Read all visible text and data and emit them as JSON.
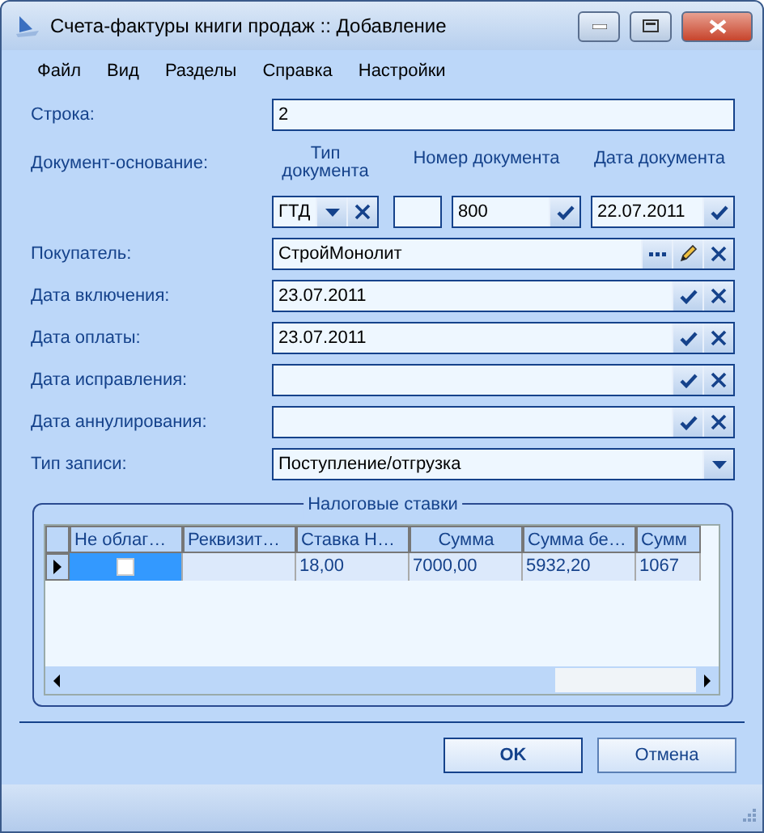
{
  "window": {
    "title": "Счета-фактуры книги продаж :: Добавление"
  },
  "menu": [
    "Файл",
    "Вид",
    "Разделы",
    "Справка",
    "Настройки"
  ],
  "row_field": {
    "label": "Строка:",
    "value": "2"
  },
  "document_basis": {
    "label": "Документ-основание:",
    "headers": [
      "Тип документа",
      "Номер документа",
      "Дата документа"
    ],
    "type": "ГТД",
    "number": "800",
    "date": "22.07.2011"
  },
  "fields": [
    {
      "label": "Покупатель:",
      "value": "СтройМонолит",
      "kind": "lookup"
    },
    {
      "label": "Дата включения:",
      "value": "23.07.2011",
      "kind": "date"
    },
    {
      "label": "Дата оплаты:",
      "value": "23.07.2011",
      "kind": "date"
    },
    {
      "label": "Дата исправления:",
      "kind": "date"
    },
    {
      "label": "Дата аннулирования:",
      "kind": "date"
    },
    {
      "label": "Тип записи:",
      "value": "Поступление/отгрузка",
      "kind": "combo"
    }
  ],
  "tax_rates": {
    "title": "Налоговые ставки",
    "columns": [
      "Не облаг…",
      "Реквизит…",
      "Ставка Н…",
      "Сумма",
      "Сумма бе…",
      "Сумм"
    ],
    "rows": [
      {
        "selected": true,
        "checked": false,
        "cells": [
          "",
          "",
          "18,00",
          "7000,00",
          "5932,20",
          "1067"
        ]
      }
    ]
  },
  "buttons": [
    {
      "label": "OK",
      "default": true
    },
    {
      "label": "Отмена",
      "default": false
    }
  ]
}
